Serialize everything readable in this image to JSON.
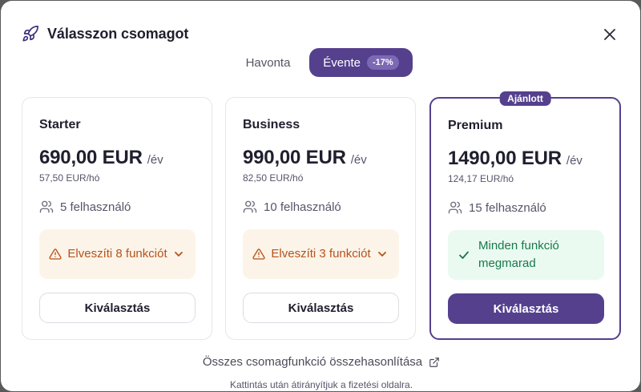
{
  "dialog": {
    "title": "Válasszon csomagot",
    "icons": {
      "title_icon": "rocket-icon",
      "close": "close-icon"
    }
  },
  "billing_toggle": {
    "monthly_label": "Havonta",
    "yearly_label": "Évente",
    "yearly_discount": "-17%",
    "selected": "yearly"
  },
  "plans": [
    {
      "name": "Starter",
      "price": "690,00 EUR",
      "period": "/év",
      "monthly_price": "57,50 EUR/hó",
      "users": "5 felhasználó",
      "notice": "Elveszíti 8 funkciót",
      "notice_type": "warning",
      "select_label": "Kiválasztás"
    },
    {
      "name": "Business",
      "price": "990,00 EUR",
      "period": "/év",
      "monthly_price": "82,50 EUR/hó",
      "users": "10 felhasználó",
      "notice": "Elveszíti 3 funkciót",
      "notice_type": "warning",
      "select_label": "Kiválasztás"
    },
    {
      "name": "Premium",
      "badge": "Ajánlott",
      "price": "1490,00 EUR",
      "period": "/év",
      "monthly_price": "124,17 EUR/hó",
      "users": "15 felhasználó",
      "notice": "Minden funkció megmarad",
      "notice_type": "success",
      "select_label": "Kiválasztás"
    }
  ],
  "compare_link": "Összes csomagfunkció összehasonlítása",
  "footnote": "Kattintás után átirányítjuk a fizetési oldalra.",
  "colors": {
    "accent": "#55408e",
    "warning_bg": "#fdf4e9",
    "warning_text": "#b6521a",
    "success_bg": "#eafaf1",
    "success_text": "#19784a"
  }
}
